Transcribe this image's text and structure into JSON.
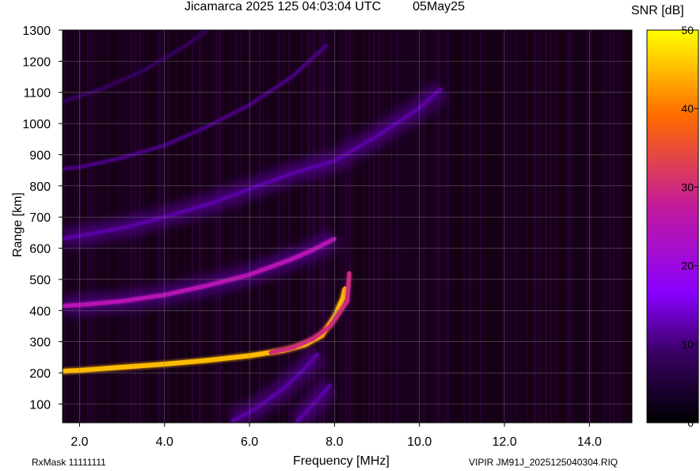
{
  "header": {
    "title": "Jicamarca 2025 125 04:03:04 UTC",
    "date": "05May25"
  },
  "footer": {
    "rxmask": "RxMask 11111111",
    "file_info": "VIPIR  JM91J_2025125040304.RIQ"
  },
  "colorbar": {
    "title": "SNR [dB]",
    "ticks": [
      "0",
      "10",
      "20",
      "30",
      "40",
      "50"
    ],
    "range": [
      0,
      50
    ],
    "colors": [
      "#000000",
      "#3a0066",
      "#8a00ff",
      "#c21a9c",
      "#ff6a00",
      "#ffff00"
    ]
  },
  "chart_data": {
    "type": "heatmap",
    "title": "Jicamarca 2025 125 04:03:04 UTC",
    "xlabel": "Frequency [MHz]",
    "ylabel": "Range [km]",
    "xlim": [
      1.6,
      15.0
    ],
    "ylim": [
      40,
      1300
    ],
    "xticks": [
      "2.0",
      "4.0",
      "6.0",
      "8.0",
      "10.0",
      "12.0",
      "14.0"
    ],
    "xtick_values": [
      2,
      4,
      6,
      8,
      10,
      12,
      14
    ],
    "yticks": [
      "100",
      "200",
      "300",
      "400",
      "500",
      "600",
      "700",
      "800",
      "900",
      "1000",
      "1100",
      "1200",
      "1300"
    ],
    "ytick_values": [
      100,
      200,
      300,
      400,
      500,
      600,
      700,
      800,
      900,
      1000,
      1100,
      1200,
      1300
    ],
    "grid": true,
    "colorbar_label": "SNR [dB]",
    "series": [
      {
        "snr_db": 45,
        "points": [
          [
            1.6,
            205
          ],
          [
            2.0,
            208
          ],
          [
            3.0,
            218
          ],
          [
            4.0,
            228
          ],
          [
            5.0,
            240
          ],
          [
            6.0,
            255
          ],
          [
            6.8,
            272
          ],
          [
            7.3,
            290
          ],
          [
            7.7,
            320
          ],
          [
            8.0,
            380
          ],
          [
            8.2,
            440
          ],
          [
            8.25,
            470
          ]
        ]
      },
      {
        "snr_db": 30,
        "points": [
          [
            6.5,
            265
          ],
          [
            7.0,
            280
          ],
          [
            7.5,
            310
          ],
          [
            7.9,
            350
          ],
          [
            8.1,
            390
          ],
          [
            8.3,
            430
          ],
          [
            8.35,
            520
          ]
        ]
      },
      {
        "snr_db": 25,
        "points": [
          [
            1.6,
            415
          ],
          [
            2.0,
            418
          ],
          [
            3.0,
            430
          ],
          [
            4.0,
            450
          ],
          [
            5.0,
            480
          ],
          [
            6.0,
            515
          ],
          [
            7.0,
            565
          ],
          [
            7.5,
            595
          ],
          [
            8.0,
            630
          ]
        ]
      },
      {
        "snr_db": 12,
        "points": [
          [
            1.6,
            630
          ],
          [
            2.0,
            640
          ],
          [
            3.0,
            665
          ],
          [
            4.0,
            700
          ],
          [
            5.0,
            740
          ],
          [
            6.0,
            790
          ],
          [
            7.0,
            840
          ],
          [
            8.0,
            880
          ],
          [
            9.0,
            960
          ],
          [
            10.0,
            1050
          ],
          [
            10.5,
            1110
          ]
        ]
      },
      {
        "snr_db": 10,
        "points": [
          [
            1.6,
            855
          ],
          [
            2.0,
            860
          ],
          [
            3.0,
            890
          ],
          [
            4.0,
            930
          ],
          [
            5.0,
            990
          ],
          [
            6.0,
            1060
          ],
          [
            7.0,
            1150
          ],
          [
            7.8,
            1250
          ]
        ]
      },
      {
        "snr_db": 8,
        "points": [
          [
            1.6,
            1070
          ],
          [
            2.5,
            1110
          ],
          [
            3.5,
            1170
          ],
          [
            4.5,
            1250
          ],
          [
            5.0,
            1300
          ]
        ]
      },
      {
        "snr_db": 12,
        "points": [
          [
            5.6,
            45
          ],
          [
            6.2,
            90
          ],
          [
            6.8,
            150
          ],
          [
            7.2,
            200
          ],
          [
            7.6,
            260
          ]
        ]
      },
      {
        "snr_db": 12,
        "points": [
          [
            7.1,
            40
          ],
          [
            7.5,
            100
          ],
          [
            7.9,
            160
          ]
        ]
      }
    ]
  }
}
